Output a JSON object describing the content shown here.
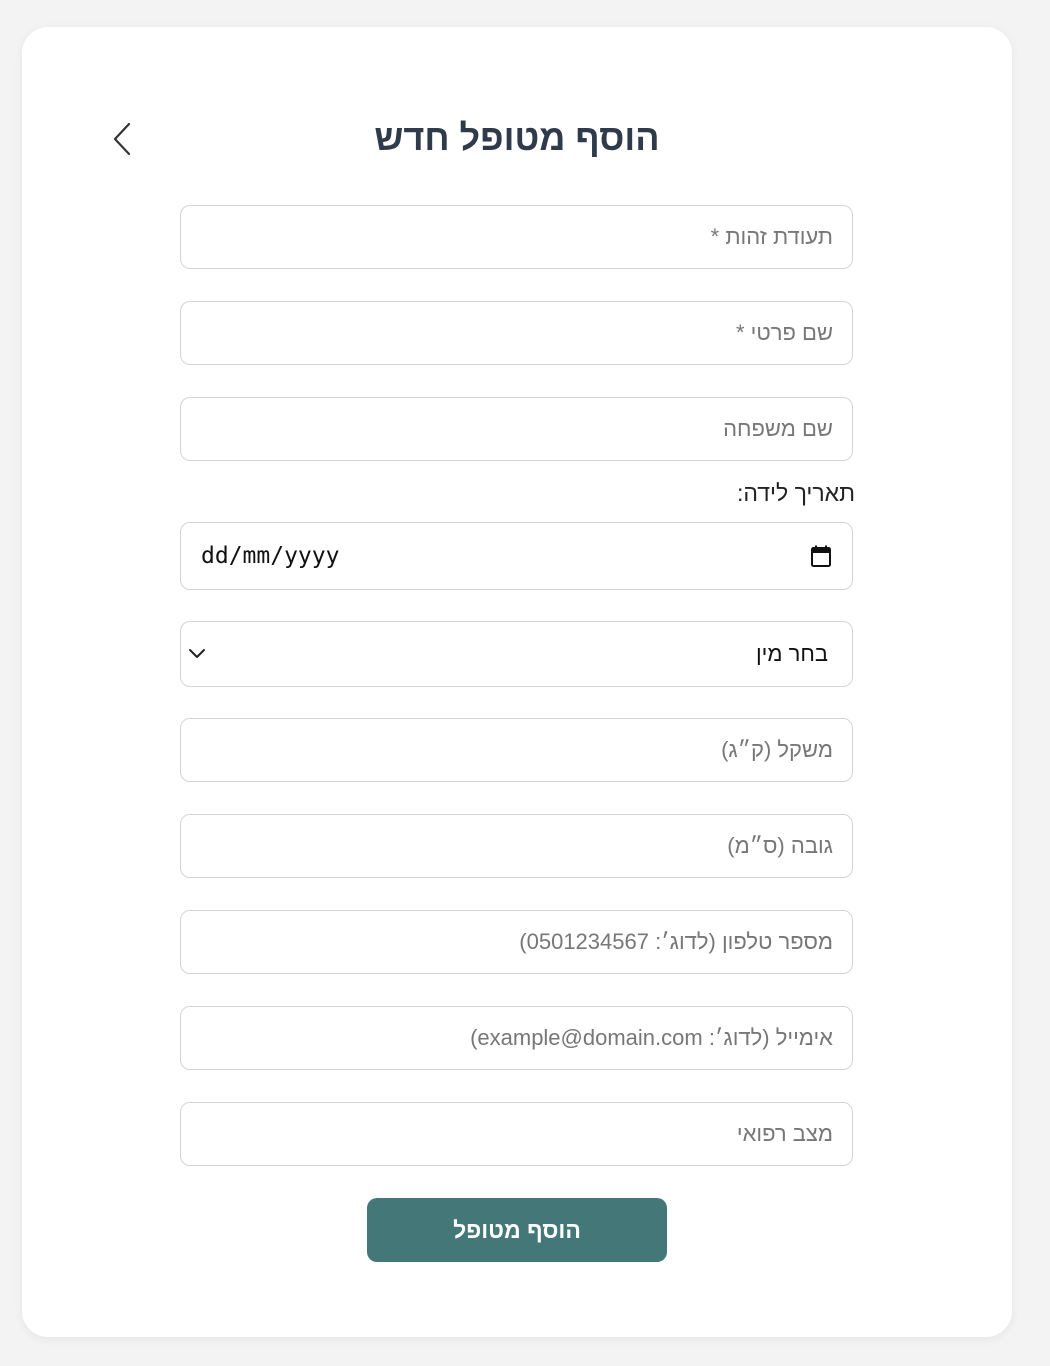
{
  "form": {
    "title": "הוסף מטופל חדש",
    "fields": {
      "id_number": {
        "placeholder": "תעודת זהות *"
      },
      "first_name": {
        "placeholder": "שם פרטי *"
      },
      "last_name": {
        "placeholder": "שם משפחה"
      },
      "birth_date": {
        "label": "תאריך לידה:",
        "placeholder": "dd/mm/yyyy"
      },
      "gender": {
        "selected": "בחר מין"
      },
      "weight": {
        "placeholder": "משקל (ק״ג)"
      },
      "height": {
        "placeholder": "גובה (ס״מ)"
      },
      "phone": {
        "placeholder": "מספר טלפון (לדוג׳: 0501234567)"
      },
      "email": {
        "placeholder": "אימייל (לדוג׳: example@domain.com)"
      },
      "medical_status": {
        "placeholder": "מצב רפואי"
      }
    },
    "submit_label": "הוסף מטופל"
  },
  "colors": {
    "accent": "#447878",
    "title": "#2f3a4a",
    "background": "#f3f3f3",
    "card": "#ffffff",
    "border": "#d4d4d4"
  },
  "icons": {
    "back": "chevron-left-icon",
    "calendar": "calendar-icon",
    "dropdown": "chevron-down-icon"
  }
}
